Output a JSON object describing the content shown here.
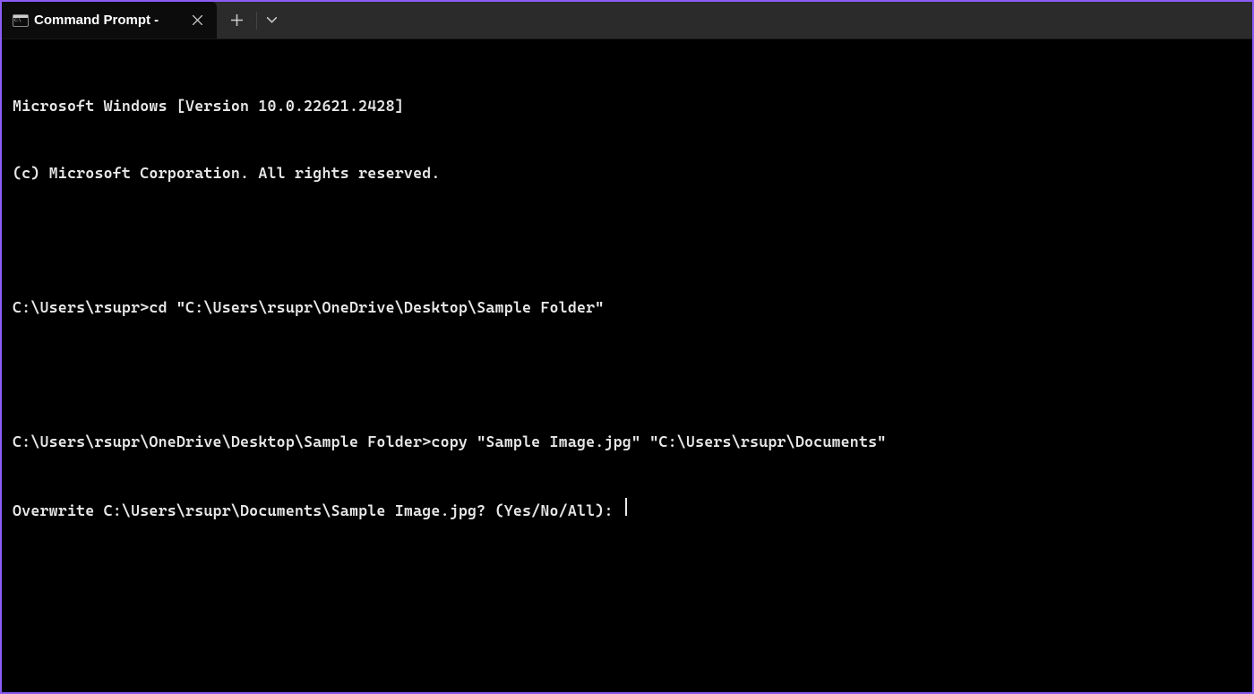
{
  "titlebar": {
    "tab_title": "Command Prompt -"
  },
  "terminal": {
    "lines": [
      "Microsoft Windows [Version 10.0.22621.2428]",
      "(c) Microsoft Corporation. All rights reserved.",
      "",
      "C:\\Users\\rsupr>cd \"C:\\Users\\rsupr\\OneDrive\\Desktop\\Sample Folder\"",
      "",
      "C:\\Users\\rsupr\\OneDrive\\Desktop\\Sample Folder>copy \"Sample Image.jpg\" \"C:\\Users\\rsupr\\Documents\""
    ],
    "prompt": "Overwrite C:\\Users\\rsupr\\Documents\\Sample Image.jpg? (Yes/No/All): "
  }
}
